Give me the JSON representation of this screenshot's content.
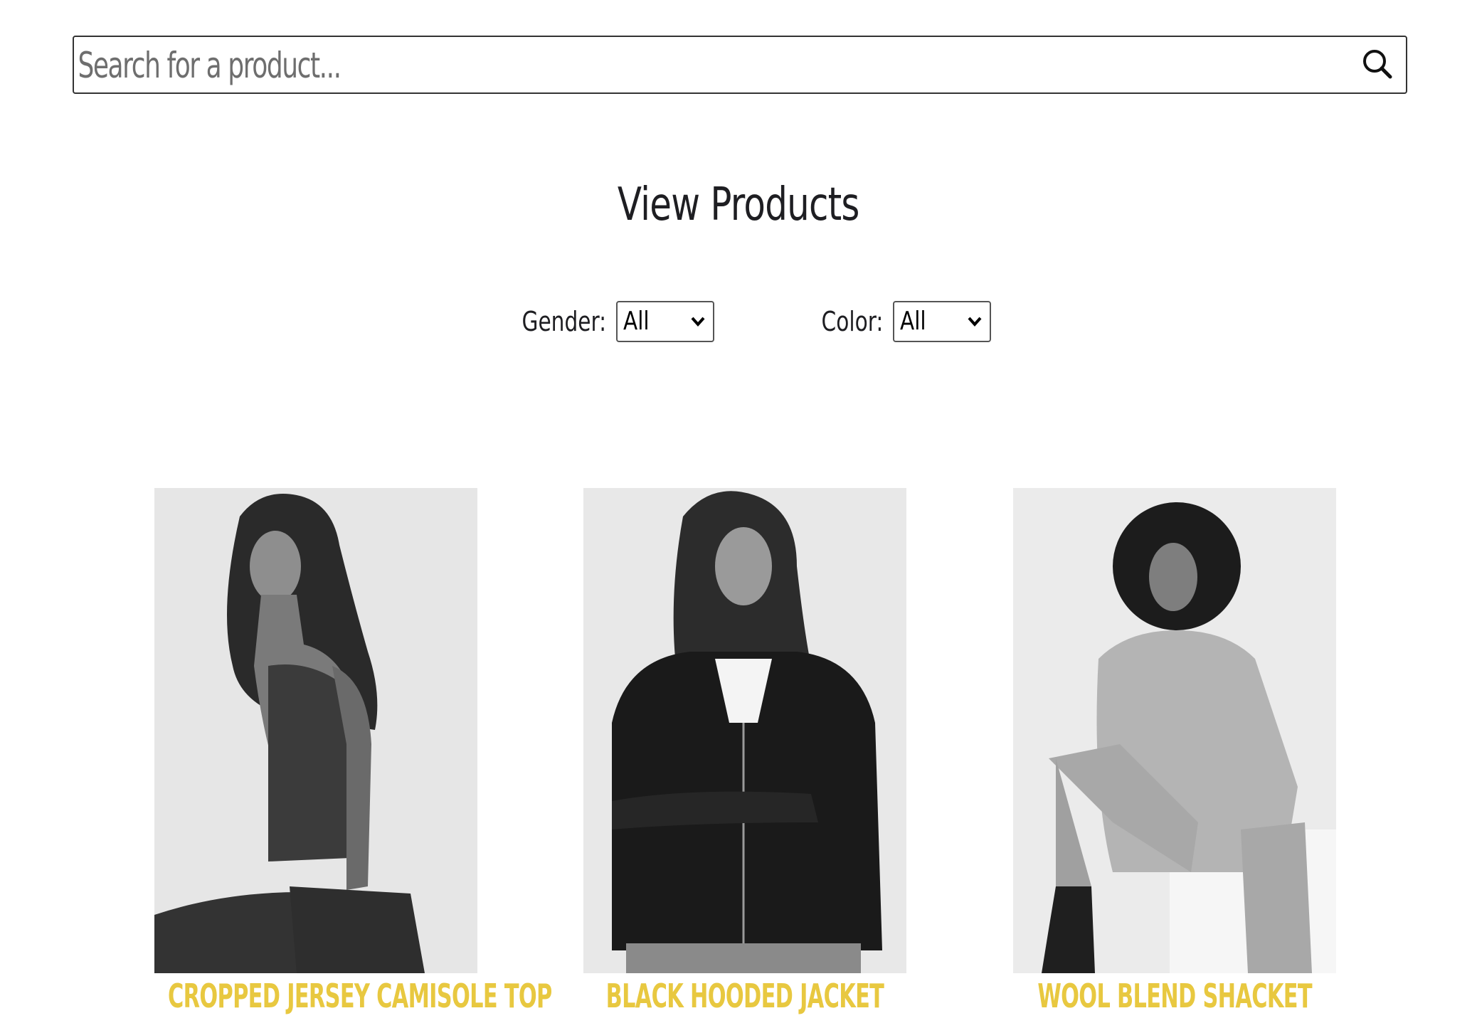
{
  "search": {
    "placeholder": "Search for a product...",
    "icon": "search-icon"
  },
  "title": "View Products",
  "filters": {
    "gender": {
      "label": "Gender:",
      "selected": "All"
    },
    "color": {
      "label": "Color:",
      "selected": "All"
    }
  },
  "products": [
    {
      "name": "CROPPED JERSEY CAMISOLE TOP"
    },
    {
      "name": "BLACK HOODED JACKET"
    },
    {
      "name": "WOOL BLEND SHACKET"
    }
  ],
  "colors": {
    "product_name": "#e8c840",
    "title": "#1e1e22",
    "border": "#333333"
  }
}
